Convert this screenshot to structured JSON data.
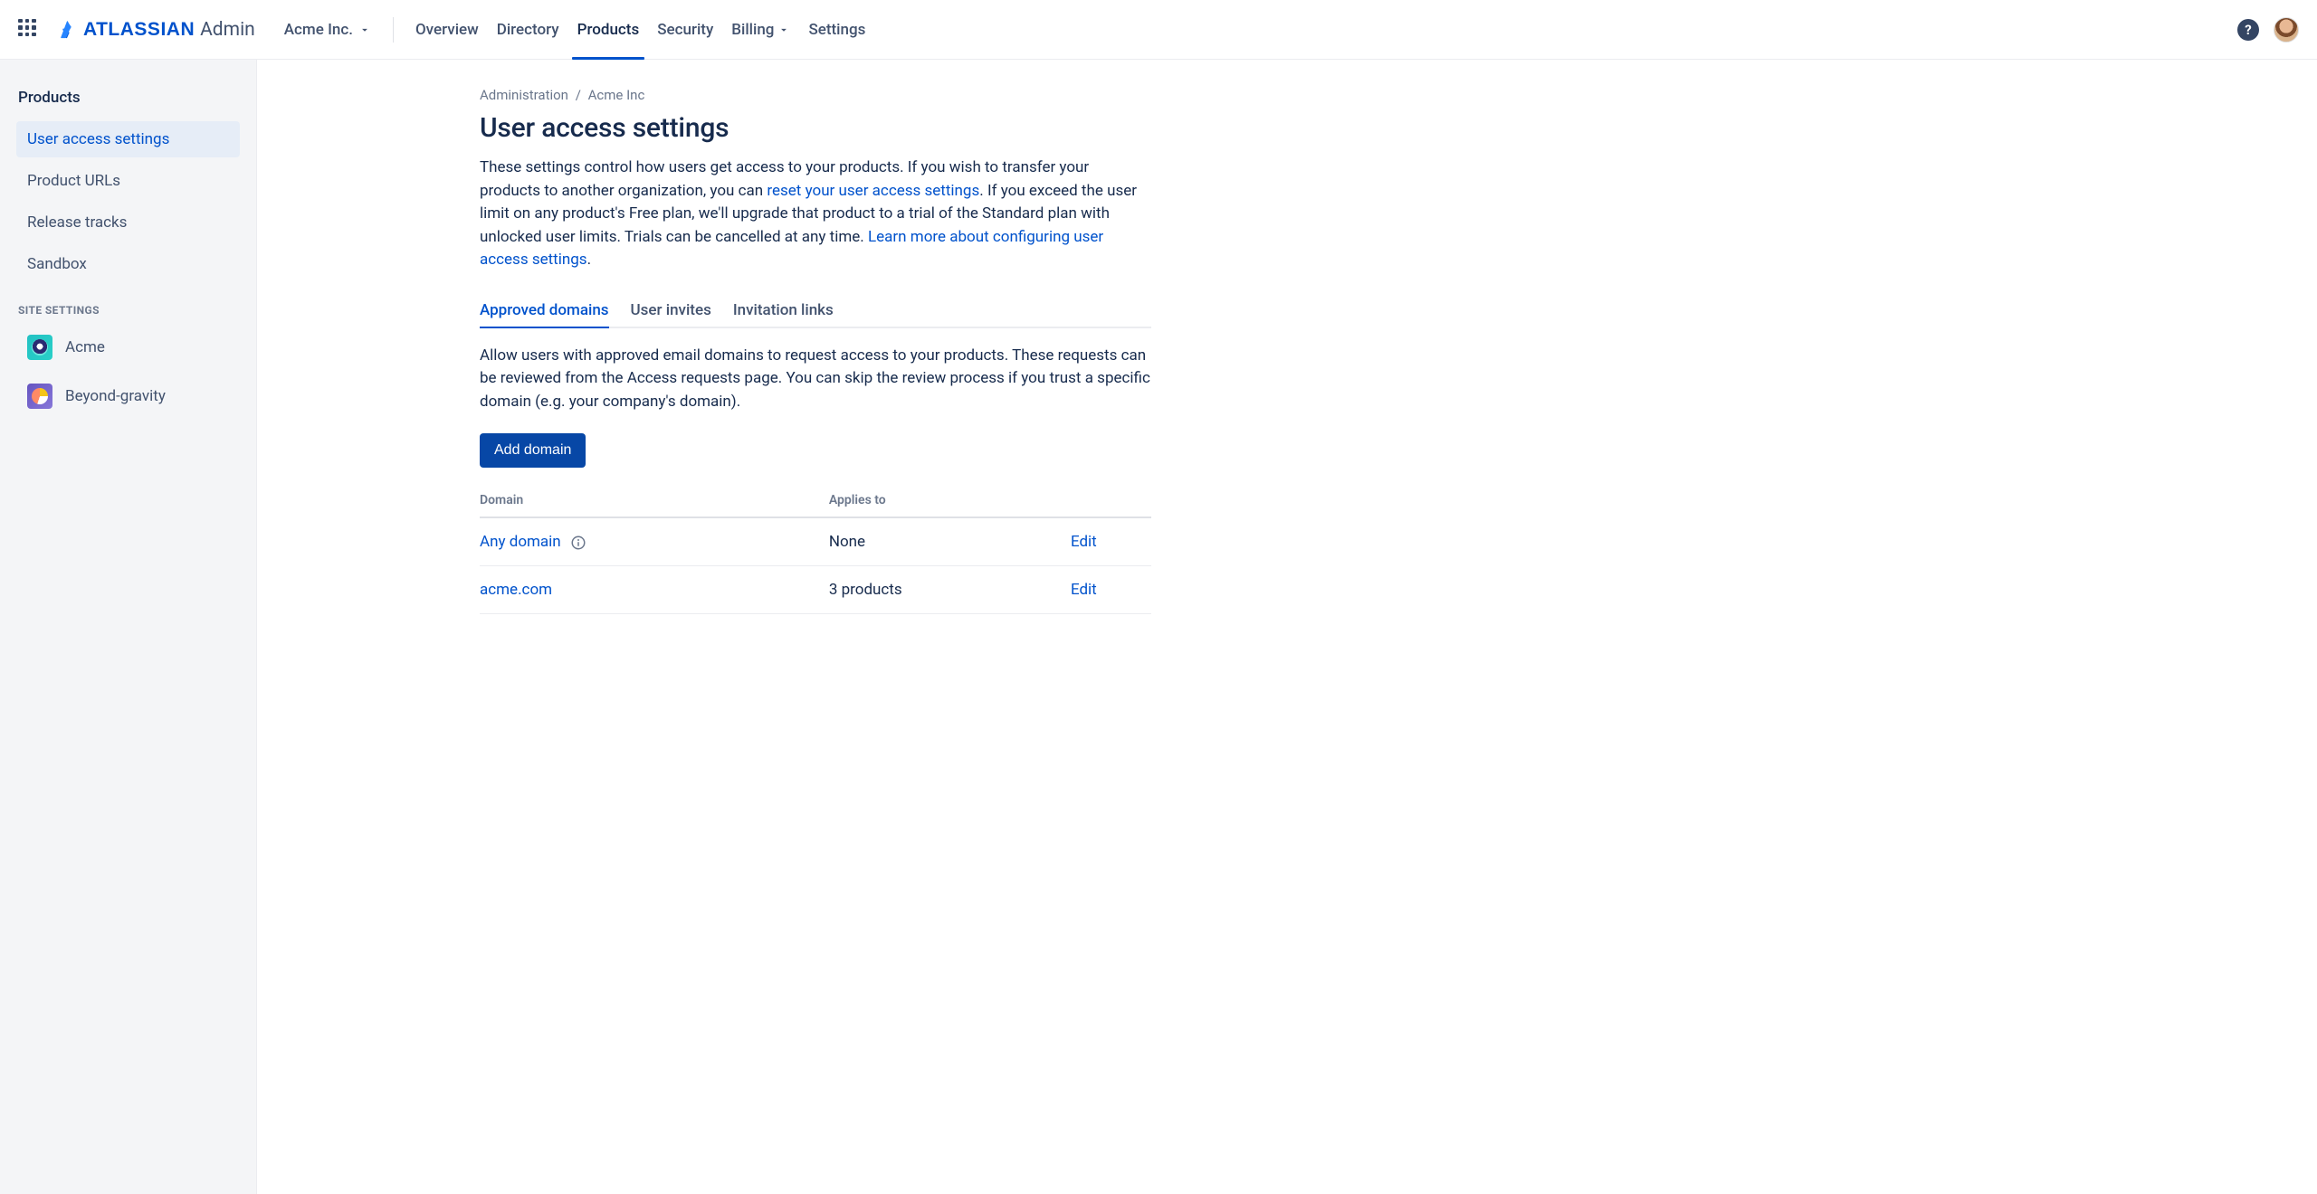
{
  "brand": {
    "name": "ATLASSIAN",
    "suffix": "Admin"
  },
  "org": {
    "name": "Acme Inc."
  },
  "nav": {
    "items": [
      {
        "label": "Overview",
        "active": false
      },
      {
        "label": "Directory",
        "active": false
      },
      {
        "label": "Products",
        "active": true
      },
      {
        "label": "Security",
        "active": false
      },
      {
        "label": "Billing",
        "active": false,
        "chevron": true
      },
      {
        "label": "Settings",
        "active": false
      }
    ]
  },
  "sidebar": {
    "heading": "Products",
    "items": [
      {
        "label": "User access settings",
        "active": true
      },
      {
        "label": "Product URLs",
        "active": false
      },
      {
        "label": "Release tracks",
        "active": false
      },
      {
        "label": "Sandbox",
        "active": false
      }
    ],
    "site_settings_label": "SITE SETTINGS",
    "sites": [
      {
        "label": "Acme",
        "icon": "acme"
      },
      {
        "label": "Beyond-gravity",
        "icon": "bg"
      }
    ]
  },
  "breadcrumb": {
    "root": "Administration",
    "sep": "/",
    "org": "Acme Inc"
  },
  "page": {
    "title": "User access settings",
    "desc_pre": "These settings control how users get access to your products. If you wish to transfer your products to another organization, you can ",
    "desc_link1": "reset your user access settings",
    "desc_mid": ". If you exceed the user limit on any product's Free plan, we'll upgrade that product to a trial of the Standard plan with unlocked user limits. Trials can be cancelled at any time. ",
    "desc_link2": "Learn more about configuring user access settings",
    "desc_post": "."
  },
  "tabs": [
    {
      "label": "Approved domains",
      "active": true
    },
    {
      "label": "User invites",
      "active": false
    },
    {
      "label": "Invitation links",
      "active": false
    }
  ],
  "approved_domains": {
    "desc": "Allow users with approved email domains to request access to your products. These requests can be reviewed from the Access requests page. You can skip the review process if you trust a specific domain (e.g. your company's domain).",
    "add_button": "Add domain",
    "columns": {
      "domain": "Domain",
      "applies": "Applies to"
    },
    "rows": [
      {
        "domain": "Any domain",
        "info": true,
        "applies": "None",
        "action": "Edit"
      },
      {
        "domain": "acme.com",
        "info": false,
        "applies": "3 products",
        "action": "Edit"
      }
    ]
  }
}
